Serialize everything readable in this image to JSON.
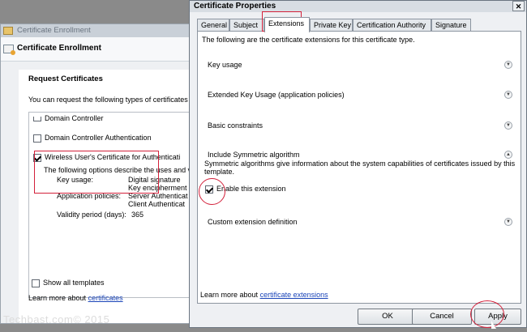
{
  "background_window": {
    "title": "Certificate Enrollment",
    "header": "Certificate Enrollment",
    "section_title": "Request Certificates",
    "intro": "You can request the following types of certificates",
    "items": [
      {
        "label": "Domain Controller",
        "checked": false
      },
      {
        "label": "Domain Controller Authentication",
        "checked": false
      },
      {
        "label": "Wireless User's Certificate for Authenticati",
        "checked": true
      }
    ],
    "details_intro": "The following options describe the uses and v",
    "key_usage_label": "Key usage:",
    "key_usage_values": [
      "Digital signature",
      "Key encipherment"
    ],
    "app_policies_label": "Application policies:",
    "app_policies_values": [
      "Server Authenticat",
      "Client Authenticat"
    ],
    "validity_label": "Validity period (days):",
    "validity_value": "365",
    "show_all": "Show all templates",
    "learn_more_prefix": "Learn more about",
    "learn_more_link": "certificates"
  },
  "dialog": {
    "title": "Certificate Properties",
    "close_glyph": "✕",
    "tabs": [
      "General",
      "Subject",
      "Extensions",
      "Private Key",
      "Certification Authority",
      "Signature"
    ],
    "selected_tab": "Extensions",
    "description": "The following are the certificate extensions for this certificate type.",
    "extensions": [
      "Key usage",
      "Extended Key Usage (application policies)",
      "Basic constraints",
      "Include Symmetric algorithm"
    ],
    "symmetric_text": "Symmetric algorithms give information about the system capabilities of certificates issued by this template.",
    "enable_label": "Enable this extension",
    "enable_checked": true,
    "custom_extension": "Custom extension definition",
    "learn_more_prefix": "Learn more about",
    "learn_more_link": "certificate extensions",
    "buttons": {
      "ok": "OK",
      "cancel": "Cancel",
      "apply": "Apply"
    }
  },
  "watermark": "Techbast.com© 2015",
  "colors": {
    "annotation_red": "#d3203a",
    "link": "#1a44b8"
  }
}
